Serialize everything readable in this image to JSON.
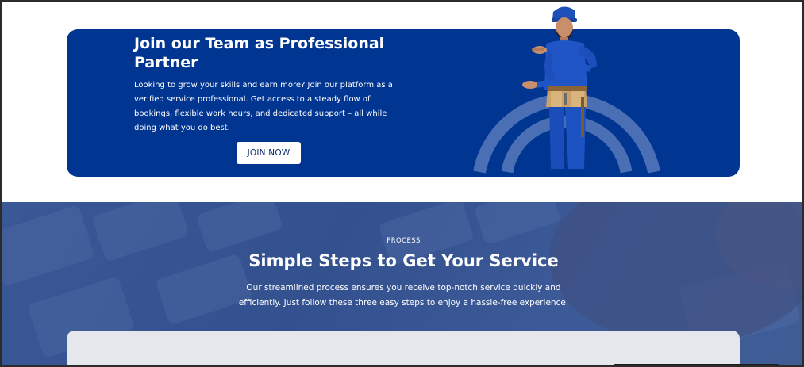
{
  "join": {
    "title": "Join our Team as Professional Partner",
    "description": "Looking to grow your skills and earn more? Join our platform as a verified service professional. Get access to a steady flow of bookings, flexible work hours, and dedicated support – all while doing what you do best.",
    "button_label": "JOIN NOW",
    "card_color": "#003591",
    "image": "worker-with-toolbelt"
  },
  "process": {
    "eyebrow": "PROCESS",
    "title": "Simple Steps to Get Your Service",
    "description": "Our streamlined process ensures you receive top-notch service quickly and efficiently. Just follow these three easy steps to enjoy a hassle-free experience.",
    "background": "keyboard-photo-overlay"
  }
}
